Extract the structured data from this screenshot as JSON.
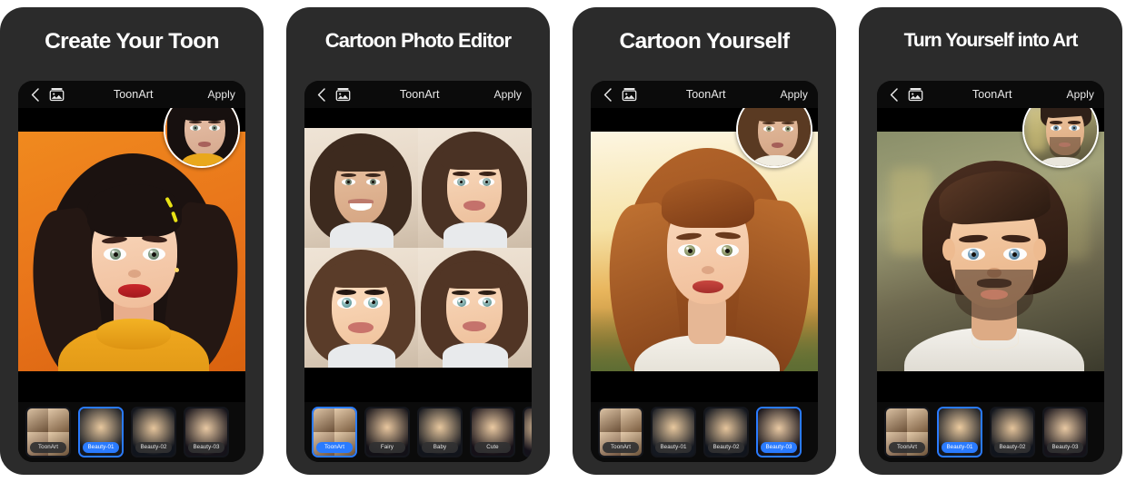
{
  "page": {
    "background": "#ffffff",
    "panel_background": "#2b2b2b",
    "screen_background": "#0b0b0b",
    "accent_selected": "#2a7bff"
  },
  "panels": [
    {
      "headline": "Create Your Toon",
      "appbar": {
        "back_icon": "chevron-left-icon",
        "gallery_icon": "photo-gallery-icon",
        "title": "ToonArt",
        "apply_label": "Apply"
      },
      "preview": {
        "style": "single-portrait",
        "background": "orange"
      },
      "thumbnails": [
        {
          "label": "ToonArt",
          "selected": false,
          "grid": true
        },
        {
          "label": "Beauty-01",
          "selected": true,
          "grid": false
        },
        {
          "label": "Beauty-02",
          "selected": false,
          "grid": false
        },
        {
          "label": "Beauty-03",
          "selected": false,
          "grid": false
        }
      ]
    },
    {
      "headline": "Cartoon Photo Editor",
      "appbar": {
        "back_icon": "chevron-left-icon",
        "gallery_icon": "photo-gallery-icon",
        "title": "ToonArt",
        "apply_label": "Apply"
      },
      "preview": {
        "style": "four-up-grid",
        "background": "studio"
      },
      "thumbnails": [
        {
          "label": "ToonArt",
          "selected": true,
          "grid": true
        },
        {
          "label": "Fairy",
          "selected": false,
          "grid": false
        },
        {
          "label": "Baby",
          "selected": false,
          "grid": false
        },
        {
          "label": "Cute",
          "selected": false,
          "grid": false
        },
        {
          "label": "",
          "selected": false,
          "grid": false,
          "partial": true
        }
      ]
    },
    {
      "headline": "Cartoon Yourself",
      "appbar": {
        "back_icon": "chevron-left-icon",
        "gallery_icon": "photo-gallery-icon",
        "title": "ToonArt",
        "apply_label": "Apply"
      },
      "preview": {
        "style": "single-portrait",
        "background": "sunset"
      },
      "thumbnails": [
        {
          "label": "ToonArt",
          "selected": false,
          "grid": true
        },
        {
          "label": "Beauty-01",
          "selected": false,
          "grid": false
        },
        {
          "label": "Beauty-02",
          "selected": false,
          "grid": false
        },
        {
          "label": "Beauty-03",
          "selected": true,
          "grid": false
        }
      ]
    },
    {
      "headline": "Turn Yourself into Art",
      "appbar": {
        "back_icon": "chevron-left-icon",
        "gallery_icon": "photo-gallery-icon",
        "title": "ToonArt",
        "apply_label": "Apply"
      },
      "preview": {
        "style": "single-portrait-male",
        "background": "cafe"
      },
      "thumbnails": [
        {
          "label": "ToonArt",
          "selected": false,
          "grid": true
        },
        {
          "label": "Beauty-01",
          "selected": true,
          "grid": false
        },
        {
          "label": "Beauty-02",
          "selected": false,
          "grid": false
        },
        {
          "label": "Beauty-03",
          "selected": false,
          "grid": false
        }
      ]
    }
  ]
}
